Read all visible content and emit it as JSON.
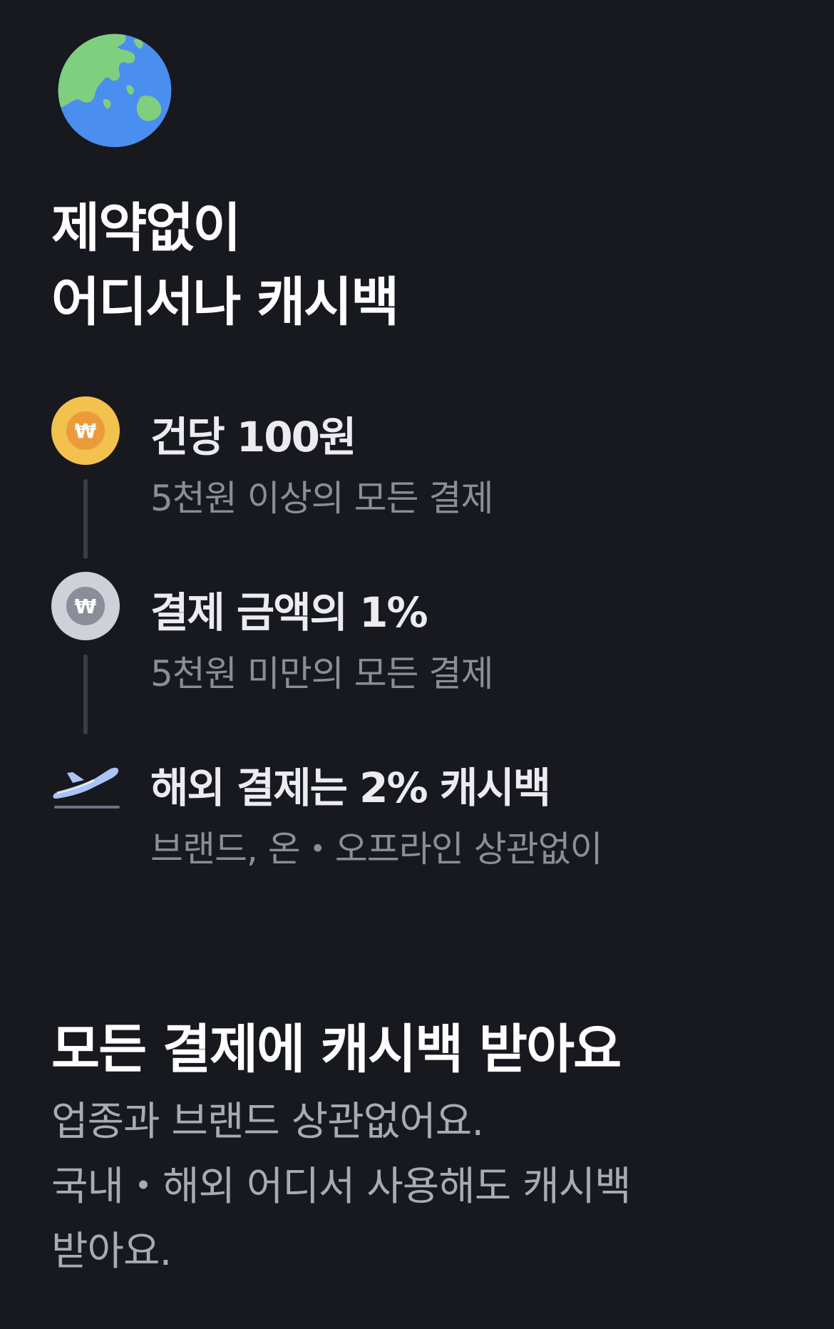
{
  "hero": {
    "icon": "globe-icon",
    "title_line1": "제약없이",
    "title_line2": "어디서나 캐시백"
  },
  "steps": [
    {
      "icon": "gold-won-coin-icon",
      "icon_color": "#f2c14e",
      "title": "건당 100원",
      "subtitle": "5천원 이상의 모든 결제"
    },
    {
      "icon": "silver-won-coin-icon",
      "icon_color": "#cfd1d8",
      "title": "결제 금액의 1%",
      "subtitle": "5천원 미만의 모든 결제"
    },
    {
      "icon": "airplane-icon",
      "icon_color": "#a9c4f7",
      "title": "해외 결제는 2% 캐시백",
      "subtitle": "브랜드, 온・오프라인 상관없이"
    }
  ],
  "section": {
    "title": "모든 결제에 캐시백 받아요",
    "desc_line1": "업종과 브랜드 상관없어요.",
    "desc_line2": "국내・해외 어디서 사용해도 캐시백",
    "desc_line3": "받아요."
  },
  "coin_symbol": "₩",
  "colors": {
    "background": "#18181f",
    "title": "#ffffff",
    "subtitle": "#8c8d96",
    "gold_inner": "#ec9b3b",
    "silver_inner": "#8b8e99"
  }
}
